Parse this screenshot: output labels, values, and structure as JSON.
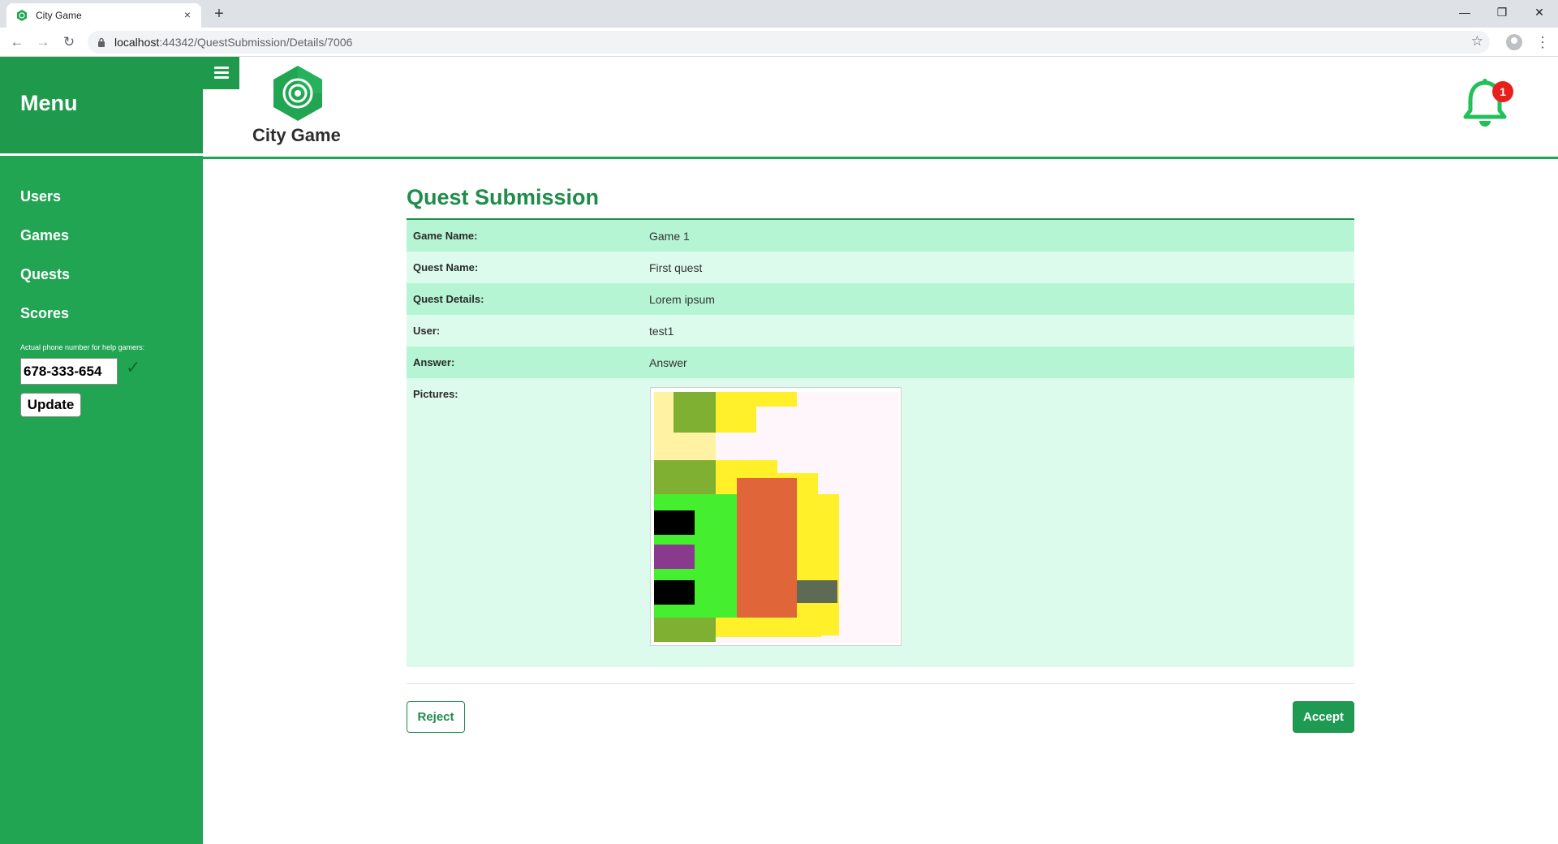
{
  "browser": {
    "tab_title": "City Game",
    "tab_close": "×",
    "new_tab": "+",
    "url_host": "localhost",
    "url_rest": ":44342/QuestSubmission/Details/7006",
    "window_controls": {
      "minimize": "—",
      "restore": "❐",
      "close": "✕"
    },
    "nav": {
      "back": "←",
      "forward": "→",
      "reload": "↻",
      "bookmark": "☆",
      "menu": "⋮"
    }
  },
  "sidebar": {
    "title": "Menu",
    "items": [
      {
        "label": "Users"
      },
      {
        "label": "Games"
      },
      {
        "label": "Quests"
      },
      {
        "label": "Scores"
      }
    ],
    "phone_label": "Actual phone number for help gamers:",
    "phone_value": "678-333-654",
    "check_icon": "✓",
    "update_label": "Update"
  },
  "header": {
    "brand": "City Game",
    "notification_count": "1"
  },
  "main": {
    "title": "Quest Submission",
    "fields": [
      {
        "label": "Game Name:",
        "value": "Game 1"
      },
      {
        "label": "Quest Name:",
        "value": "First quest"
      },
      {
        "label": "Quest Details:",
        "value": "Lorem ipsum"
      },
      {
        "label": "User:",
        "value": "test1"
      },
      {
        "label": "Answer:",
        "value": "Answer"
      }
    ],
    "pictures_label": "Pictures:",
    "reject_label": "Reject",
    "accept_label": "Accept"
  },
  "colors": {
    "sidebar": "#21a552",
    "accent": "#1f8c4a",
    "row_dark": "#b6f5d4",
    "row_light": "#dcfbec",
    "badge": "#e8201c"
  },
  "icons": [
    "hamburger-icon",
    "target-logo-icon",
    "bell-icon",
    "check-icon",
    "lock-icon",
    "star-icon",
    "profile-icon"
  ]
}
